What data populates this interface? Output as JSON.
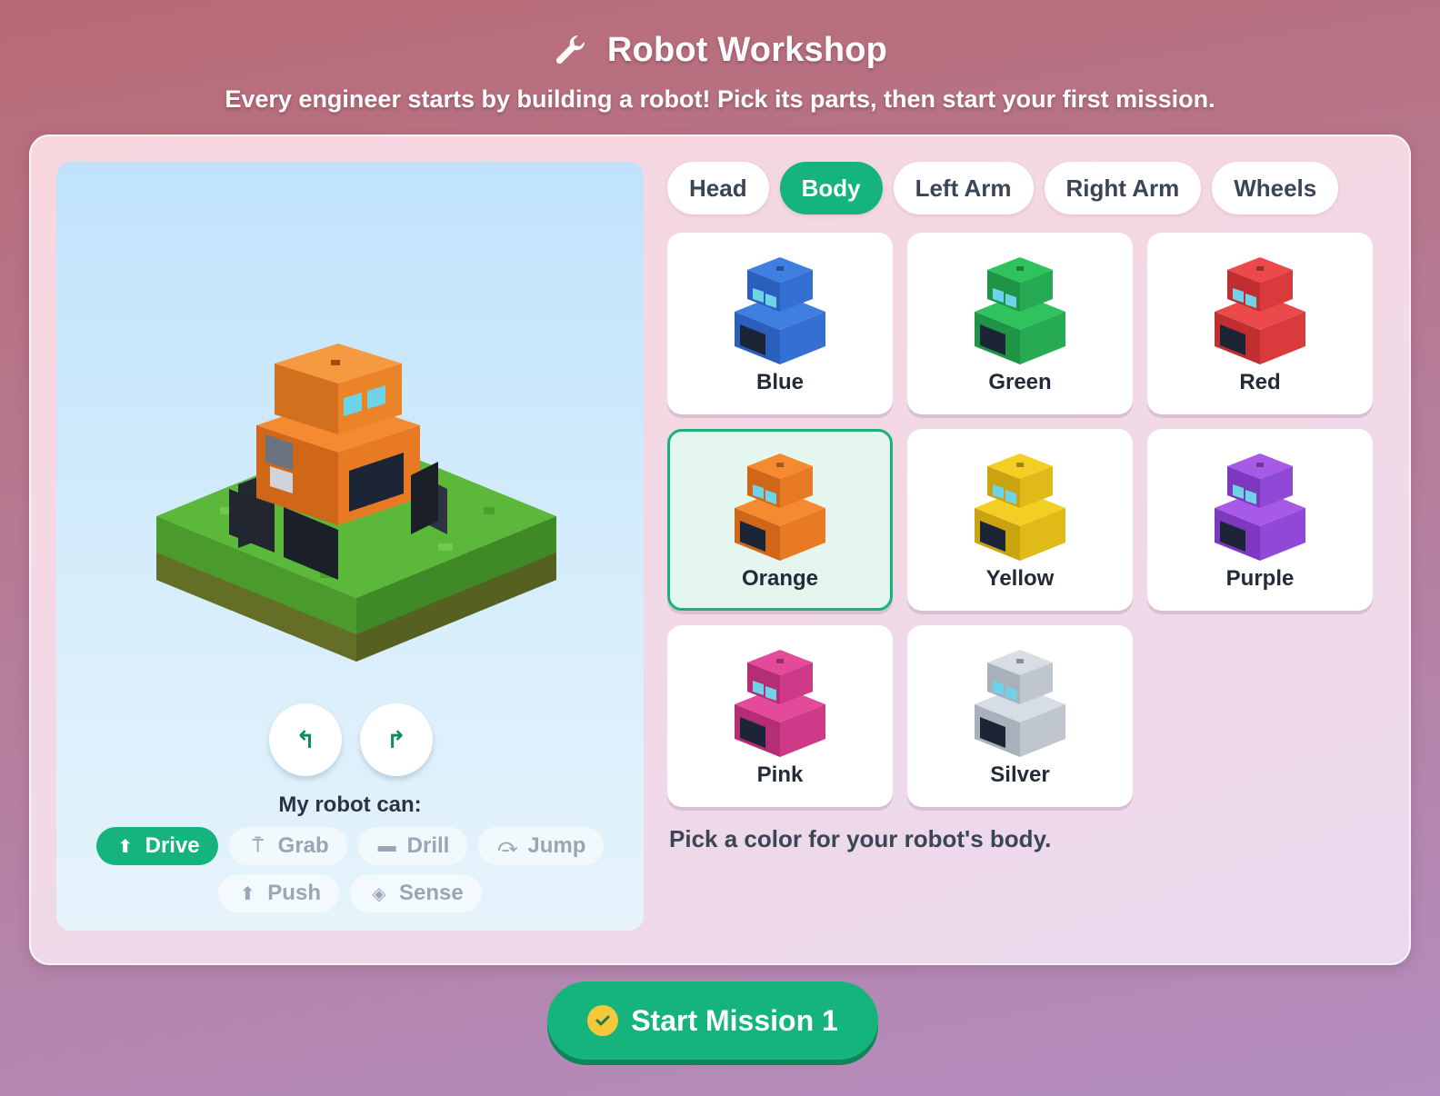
{
  "header": {
    "title": "Robot Workshop",
    "subtitle": "Every engineer starts by building a robot! Pick its parts, then start your first mission."
  },
  "stage": {
    "rotate_left_icon": "↰",
    "rotate_right_icon": "↱",
    "abilities_label": "My robot can:",
    "abilities": [
      {
        "label": "Drive",
        "icon": "⬆",
        "active": true
      },
      {
        "label": "Grab",
        "icon": "⍑",
        "active": false
      },
      {
        "label": "Drill",
        "icon": "▬",
        "active": false
      },
      {
        "label": "Jump",
        "icon": "⤼",
        "active": false
      },
      {
        "label": "Push",
        "icon": "⬆",
        "active": false
      },
      {
        "label": "Sense",
        "icon": "◈",
        "active": false
      }
    ]
  },
  "tabs": [
    {
      "label": "Head",
      "active": false
    },
    {
      "label": "Body",
      "active": true
    },
    {
      "label": "Left Arm",
      "active": false
    },
    {
      "label": "Right Arm",
      "active": false
    },
    {
      "label": "Wheels",
      "active": false
    }
  ],
  "colors": [
    {
      "label": "Blue",
      "top": "#3f7fe0",
      "left": "#2a5fbd",
      "right": "#3470d4",
      "selected": false
    },
    {
      "label": "Green",
      "top": "#2fc35e",
      "left": "#1f9446",
      "right": "#26ab52",
      "selected": false
    },
    {
      "label": "Red",
      "top": "#ec4a4a",
      "left": "#bf2e30",
      "right": "#d93b3d",
      "selected": false
    },
    {
      "label": "Orange",
      "top": "#f58a30",
      "left": "#cf6618",
      "right": "#e97a24",
      "selected": true
    },
    {
      "label": "Yellow",
      "top": "#f2cf22",
      "left": "#c9a410",
      "right": "#e0bb18",
      "selected": false
    },
    {
      "label": "Purple",
      "top": "#a65ae6",
      "left": "#7d38c0",
      "right": "#9049d6",
      "selected": false
    },
    {
      "label": "Pink",
      "top": "#e34a9a",
      "left": "#b52d74",
      "right": "#cf3a88",
      "selected": false
    },
    {
      "label": "Silver",
      "top": "#d7dde4",
      "left": "#a8b0ba",
      "right": "#bfc6cf",
      "selected": false
    }
  ],
  "hint": "Pick a color for your robot's body.",
  "start_button": {
    "label": "Start Mission 1"
  },
  "accent_color": "#15b47c"
}
